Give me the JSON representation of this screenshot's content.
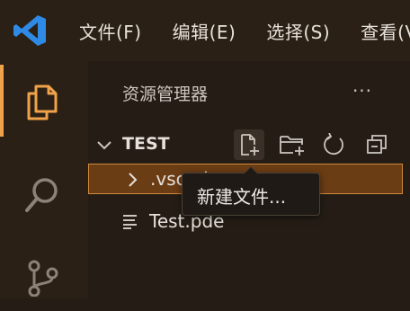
{
  "titlebar": {
    "menu": [
      "文件(F)",
      "编辑(E)",
      "选择(S)",
      "查看(V)"
    ]
  },
  "activitybar": {
    "items": [
      {
        "icon": "explorer-icon",
        "active": true
      },
      {
        "icon": "search-icon",
        "active": false
      },
      {
        "icon": "source-control-icon",
        "active": false
      }
    ]
  },
  "sidebar": {
    "title": "资源管理器",
    "more_label": "···",
    "section": {
      "name": "TEST",
      "toolbar": [
        "new-file-icon",
        "new-folder-icon",
        "refresh-icon",
        "collapse-all-icon"
      ]
    },
    "tree": [
      {
        "type": "folder",
        "name": ".vscode",
        "selected": true
      },
      {
        "type": "file",
        "name": "Test.pde",
        "selected": false
      }
    ]
  },
  "tooltip": {
    "text": "新建文件..."
  },
  "colors": {
    "accent": "#f0a24a",
    "selection_bg": "#6b3d14",
    "selection_border": "#d0883c",
    "logo": "#2f8ae6"
  }
}
